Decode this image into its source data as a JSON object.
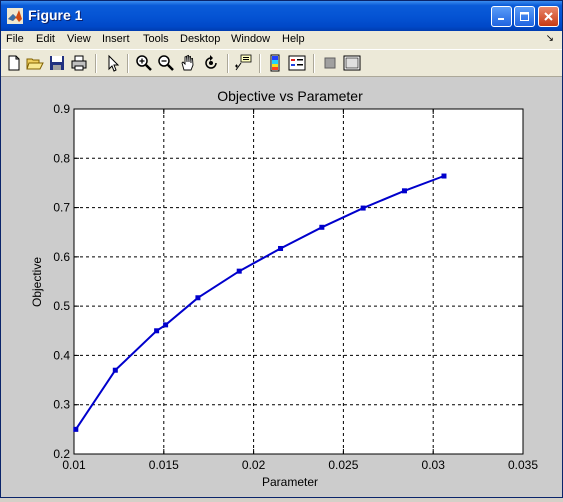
{
  "window": {
    "title": "Figure 1"
  },
  "menu": [
    "File",
    "Edit",
    "View",
    "Insert",
    "Tools",
    "Desktop",
    "Window",
    "Help"
  ],
  "toolbar_icons": [
    "new-figure-icon",
    "open-file-icon",
    "save-icon",
    "print-icon",
    "edit-plot-icon",
    "zoom-in-icon",
    "zoom-out-icon",
    "pan-icon",
    "rotate-3d-icon",
    "data-cursor-icon",
    "insert-colorbar-icon",
    "insert-legend-icon",
    "hide-plot-tools-icon",
    "show-plot-tools-icon"
  ],
  "chart_data": {
    "type": "line",
    "title": "Objective vs Parameter",
    "xlabel": "Parameter",
    "ylabel": "Objective",
    "xlim": [
      0.01,
      0.035
    ],
    "ylim": [
      0.2,
      0.9
    ],
    "xticks": [
      "0.01",
      "0.015",
      "0.02",
      "0.025",
      "0.03",
      "0.035"
    ],
    "yticks": [
      "0.2",
      "0.3",
      "0.4",
      "0.5",
      "0.6",
      "0.7",
      "0.8",
      "0.9"
    ],
    "grid": true,
    "line_color": "#0000cc",
    "series": [
      {
        "x": [
          0.0101,
          0.0123,
          0.0146,
          0.0151,
          0.0169,
          0.0192,
          0.0215,
          0.0238,
          0.0261,
          0.0284,
          0.0306
        ],
        "y": [
          0.25,
          0.37,
          0.45,
          0.462,
          0.517,
          0.571,
          0.617,
          0.66,
          0.699,
          0.734,
          0.764
        ]
      }
    ]
  }
}
